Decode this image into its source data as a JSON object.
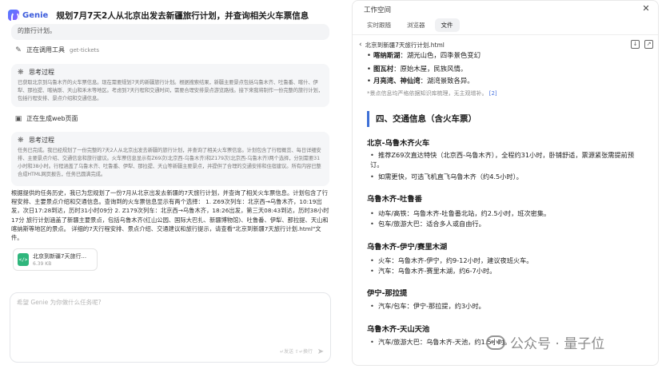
{
  "header": {
    "brand": "Genie",
    "title": "规划7月7天2人从北京出发去新疆旅行计划，并查询相关火车票信息"
  },
  "chat": {
    "prev_text": "的旅行计划。",
    "tool_1": {
      "label": "正在调用工具",
      "tool": "get-tickets"
    },
    "think_1": {
      "title": "思考过程",
      "text": "已获取北京到乌鲁木齐的火车票信息。现在需要规划7天的新疆旅行计划。根据搜索结果，新疆主要景点包括乌鲁木齐、吐鲁番、喀什、伊犁、那拉提、喀纳斯、天山和禾木等地区。考虑到7天行程和交通时间，需要合理安排景点游览路线。接下来我将制作一份完整的旅行计划，包括行程安排、景点介绍和交通信息。"
    },
    "tool_2": {
      "label": "正在生成web页面"
    },
    "think_2": {
      "title": "思考过程",
      "text": "任务已完成。我已经规划了一份完整的7天2人从北京出发去新疆的旅行计划，并查询了相关火车票信息。计划包含了行程概览、每日详细安排、主要景点介绍、交通信息和旅行建议。火车票信息显示有Z69次(北京西-乌鲁木齐)和Z179次(北京西-乌鲁木齐)两个选择，分别需要31小时和38小时。行程涵盖了乌鲁木齐、吐鲁番、伊犁、那拉提、天山等新疆主要景点，并提供了合理的交通安排和住宿建议。所有内容已整合成HTML网页报告，任务已圆满完成。"
    },
    "answer": "根据提供的任务历史，我已为您规划了一份7月从北京出发去新疆的7天旅行计划，并查询了相关火车票信息。计划包含了行程安排、主要景点介绍和交通信息。查询到的火车票信息显示有两个选择： 1. Z69次列车：北京西→乌鲁木齐，10:19出发，次日17:28到达，历时31小时09分 2. Z179次列车：北京西→乌鲁木齐，18:26出发，第三天08:43到达，历时38小时17分 旅行计划涵盖了新疆主要景点，包括乌鲁木齐(红山公园、国际大巴扎、新疆博物馆)、吐鲁番、伊犁、那拉提、天山和喀纳斯等地区的景点。 详细的7天行程安排、景点介绍、交通建议和旅行提示，请查看\"北京到新疆7天旅行计划.html\"文件。",
    "file": {
      "name": "北京到新疆7天旅行...",
      "size": "6.39 KB",
      "icon": "code-file-icon"
    },
    "composer": {
      "placeholder": "希望 Genie 为你做什么任务呢?",
      "hint": "↵发送  ⇧↵换行"
    }
  },
  "workspace": {
    "title": "工作空间",
    "tabs": [
      {
        "label": "实时跟随"
      },
      {
        "label": "浏览器"
      },
      {
        "label": "文件"
      }
    ],
    "active_tab": "文件",
    "file_path": "北京到新疆7天旅行计划.html",
    "doc": {
      "top_items": [
        {
          "bold": "喀纳斯湖",
          "text": "：湖光山色，四季景色变幻"
        },
        {
          "bold": "图瓦村",
          "text": "：原始木屋，民族风情。"
        },
        {
          "bold": "月亮湾、神仙湾",
          "text": "：湖湾景致各异。"
        }
      ],
      "note": "*景点信息均严格依据知识库梳理，无主观增补。",
      "note_ref": "[2]",
      "section_title": "四、交通信息（含火车票）",
      "routes": [
        {
          "title": "北京-乌鲁木齐火车",
          "items": [
            {
              "text": "推荐Z69次直达特快（北京西-乌鲁木齐），全程约31小时，卧铺舒适，票源紧张需提前预订。"
            },
            {
              "text": "如需更快，可选飞机直飞乌鲁木齐（约4.5小时）。"
            }
          ]
        },
        {
          "title": "乌鲁木齐-吐鲁番",
          "items": [
            {
              "text": "动车/高铁：乌鲁木齐-吐鲁番北站，约2.5小时，班次密集。"
            },
            {
              "text": "包车/旅游大巴：适合多人或自由行。"
            }
          ]
        },
        {
          "title": "乌鲁木齐-伊宁/赛里木湖",
          "items": [
            {
              "text": "火车：乌鲁木齐-伊宁，约9-12小时，建议夜班火车。"
            },
            {
              "text": "汽车：乌鲁木齐-赛里木湖，约6-7小时。"
            }
          ]
        },
        {
          "title": "伊宁-那拉提",
          "items": [
            {
              "text": "汽车/包车：伊宁-那拉提，约3小时。"
            }
          ]
        },
        {
          "title": "乌鲁木齐-天山天池",
          "items": [
            {
              "text": "汽车/旅游大巴：乌鲁木齐-天池，约1.5小时。"
            }
          ]
        }
      ]
    }
  },
  "watermark": "公众号 · 量子位",
  "colors": {
    "accent": "#3d6fd6",
    "file_icon": "#2fb67c",
    "brand": "#3b5bdb"
  }
}
